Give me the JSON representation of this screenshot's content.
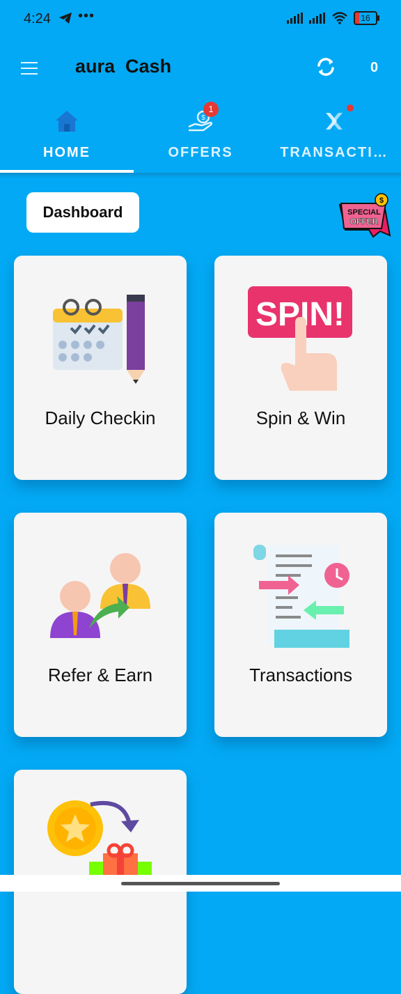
{
  "status_bar": {
    "time": "4:24",
    "dots": "•••",
    "battery": "16"
  },
  "app_bar": {
    "title": "aura  Cash",
    "coin_count": "0"
  },
  "tabs": [
    {
      "label": "HOME",
      "icon": "home-icon"
    },
    {
      "label": "OFFERS",
      "icon": "offers-icon",
      "badge": "1"
    },
    {
      "label": "TRANSACTI…",
      "icon": "transactions-icon"
    }
  ],
  "dashboard_button": "Dashboard",
  "special_offer": {
    "line1": "SPECIAL",
    "line2": "OFFER",
    "coin": "$"
  },
  "cards": [
    {
      "label": "Daily Checkin",
      "icon": "calendar-pencil-icon"
    },
    {
      "label": "Spin & Win",
      "icon": "spin-icon",
      "badge_text": "SPIN!"
    },
    {
      "label": "Refer & Earn",
      "icon": "refer-icon"
    },
    {
      "label": "Transactions",
      "icon": "transactions-doc-icon"
    },
    {
      "label": "",
      "icon": "reward-icon"
    }
  ],
  "colors": {
    "background": "#03A9F4",
    "card": "#F5F5F5",
    "badge": "#E53935"
  }
}
